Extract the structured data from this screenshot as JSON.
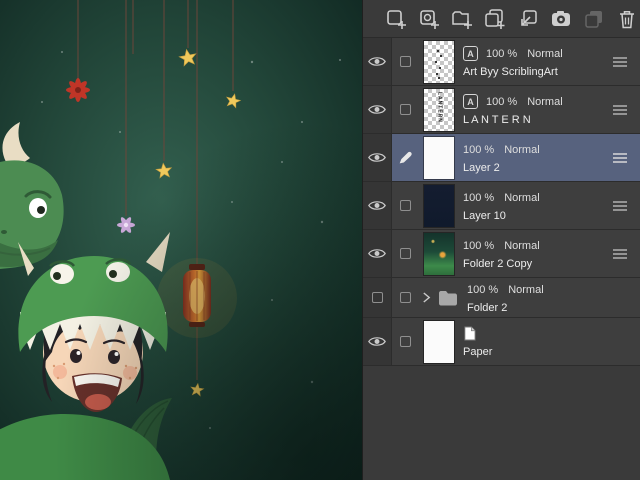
{
  "window": {
    "app": "digital-painting-app",
    "view": "layers-panel"
  },
  "colors": {
    "panel_bg": "#3a3a3a",
    "row_bg": "#3e3e3e",
    "selection": "#57627e",
    "canvas_glow": "#33604f",
    "canvas_dark": "#0e241f",
    "star_yellow": "#f0c95c",
    "lantern_orange": "#d9772f",
    "hood_green": "#4d9b52"
  },
  "toolbar": {
    "buttons": [
      "new-layer",
      "add-layer-special",
      "new-folder",
      "duplicate-layer",
      "transfer-layer",
      "camera-import",
      "layer-pair",
      "delete-layer"
    ]
  },
  "icons": {
    "text_glyph": "A"
  },
  "layers": [
    {
      "opacity": "100 %",
      "blend": "Normal",
      "name": "Art Byy ScriblingArt",
      "kind": "text",
      "visible": true,
      "selected": false
    },
    {
      "opacity": "100 %",
      "blend": "Normal",
      "name": "L A N T E R N",
      "kind": "text",
      "visible": true,
      "selected": false,
      "thumb_text": "LANTERN"
    },
    {
      "opacity": "100 %",
      "blend": "Normal",
      "name": "Layer 2",
      "kind": "raster",
      "visible": true,
      "selected": true,
      "editing": true
    },
    {
      "opacity": "100 %",
      "blend": "Normal",
      "name": "Layer 10",
      "kind": "raster",
      "visible": true,
      "selected": false
    },
    {
      "opacity": "100 %",
      "blend": "Normal",
      "name": "Folder 2 Copy",
      "kind": "raster",
      "visible": true,
      "selected": false
    },
    {
      "opacity": "100 %",
      "blend": "Normal",
      "name": "Folder 2",
      "kind": "folder",
      "visible": false,
      "selected": false,
      "collapsed": true
    },
    {
      "opacity": "",
      "blend": "",
      "name": "Paper",
      "kind": "paper",
      "visible": true,
      "selected": false
    }
  ]
}
